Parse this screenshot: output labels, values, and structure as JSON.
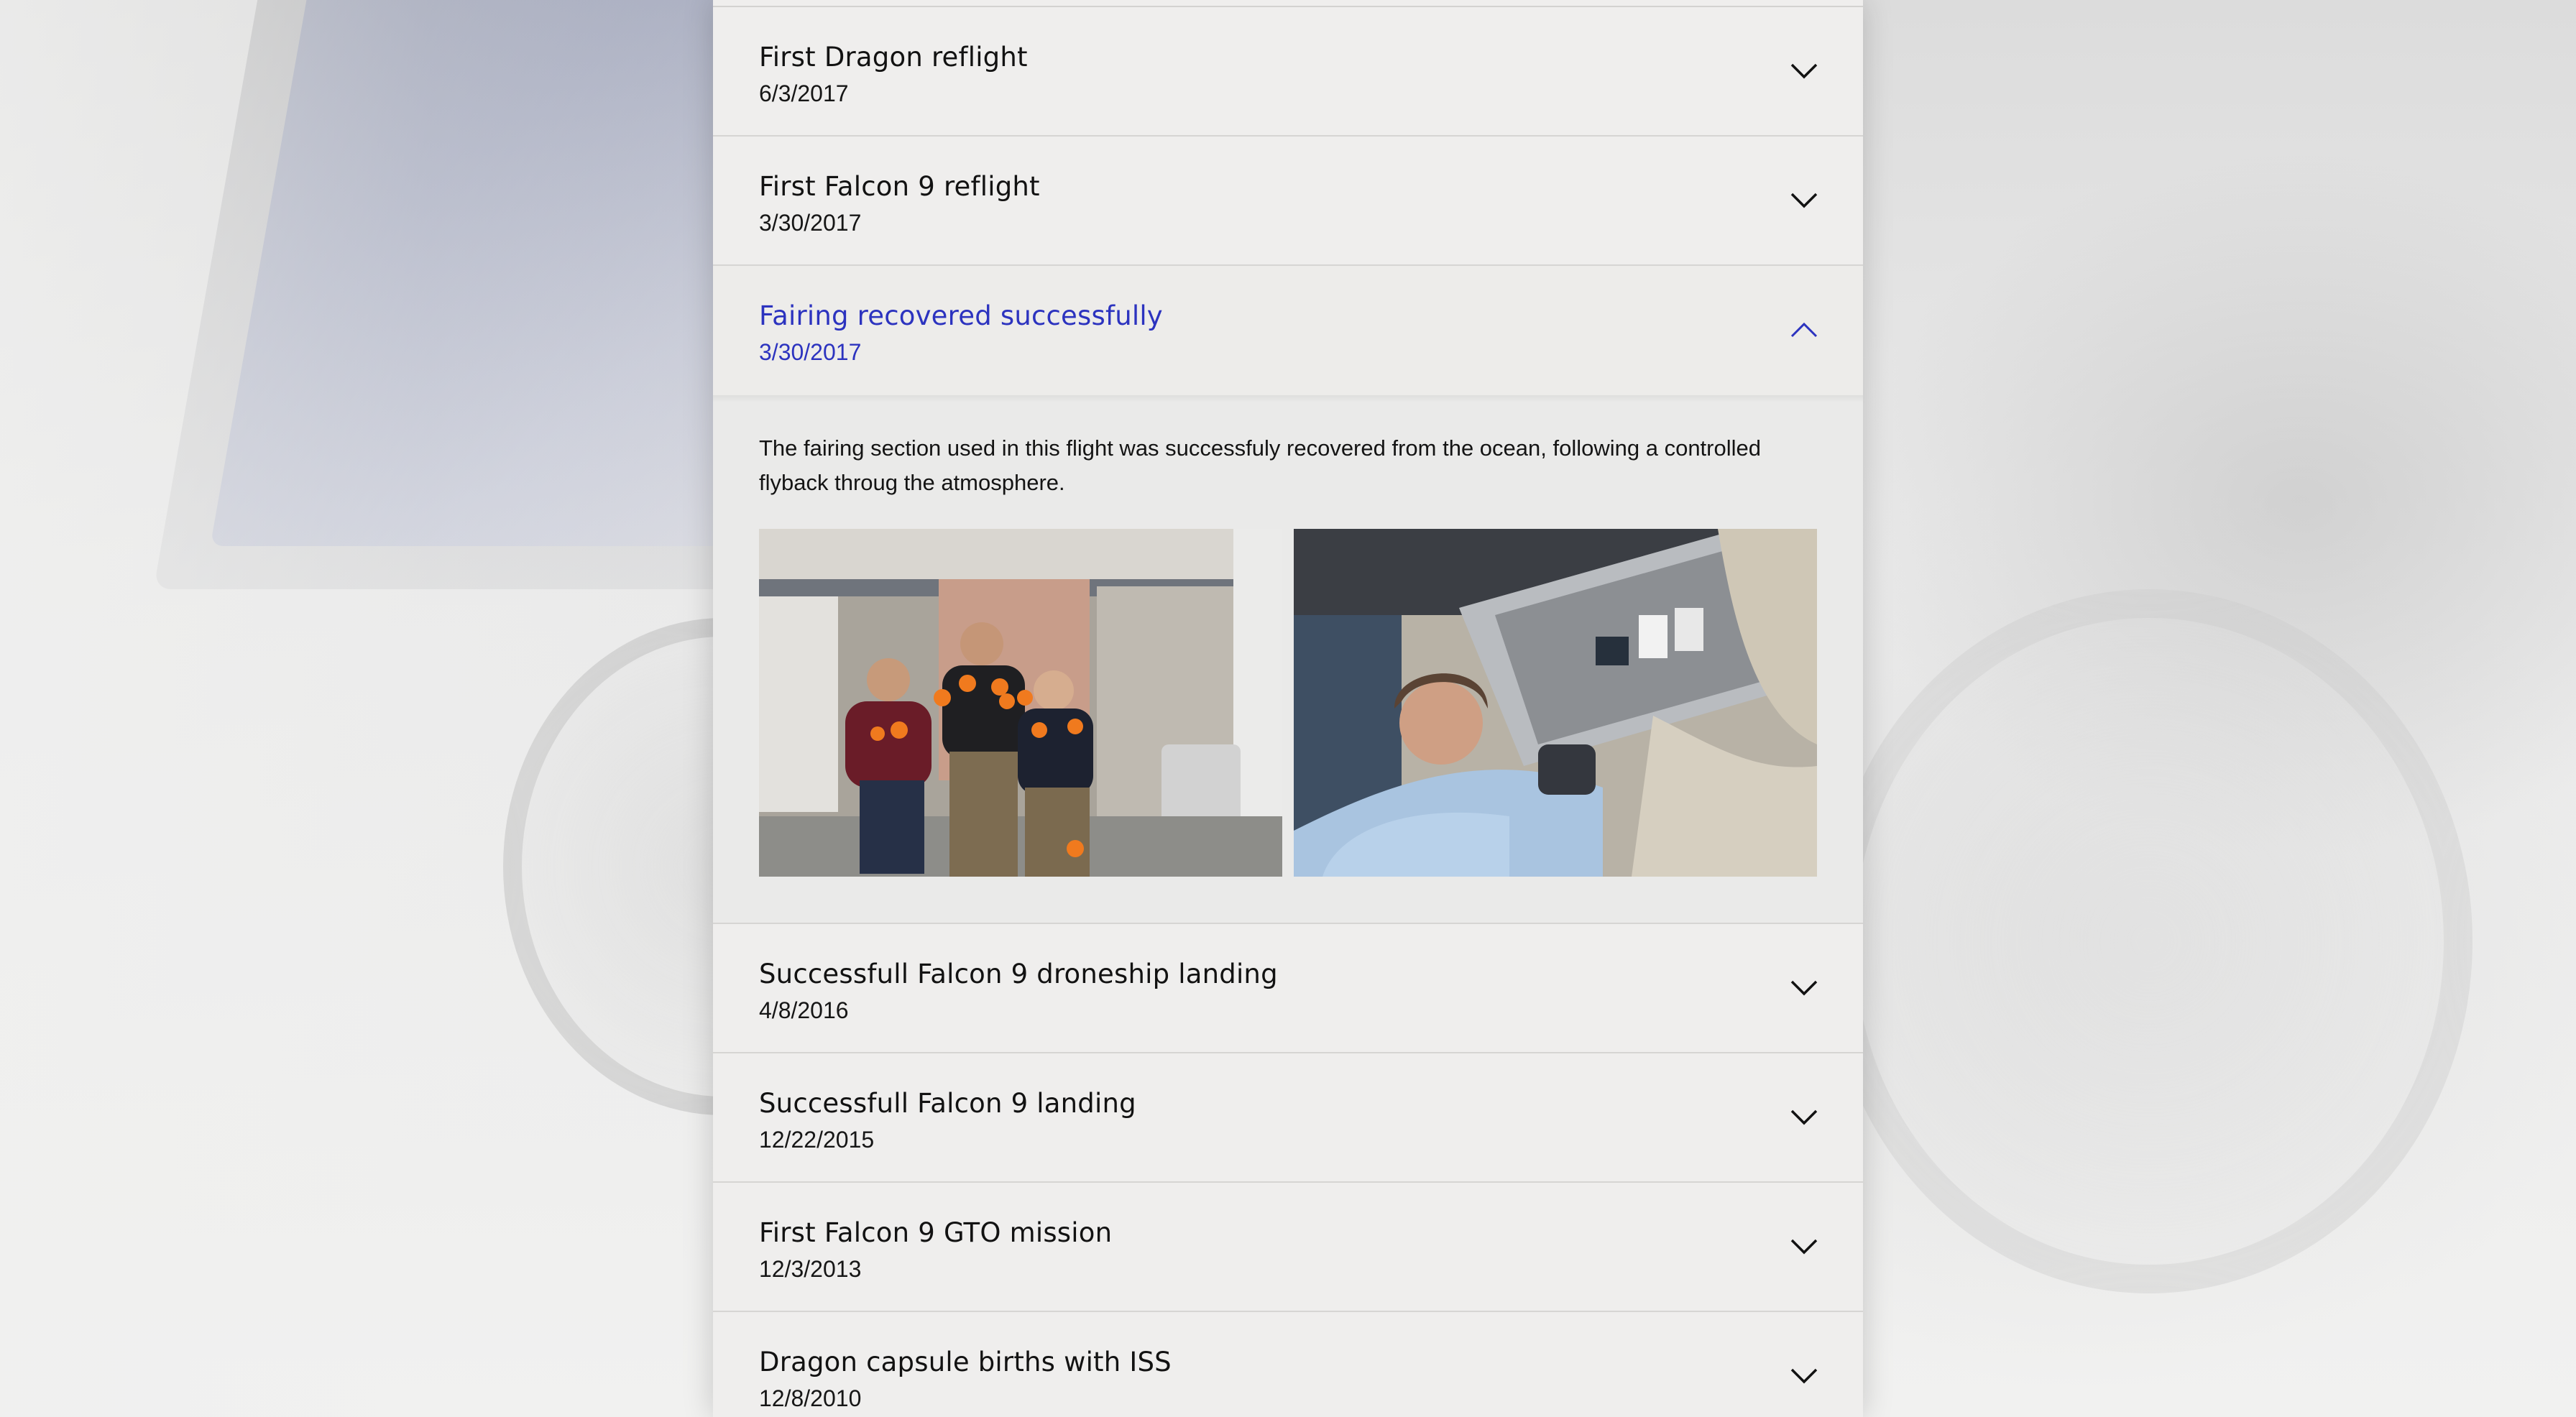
{
  "timeline": {
    "items": [
      {
        "title": "First Dragon reflight",
        "date": "6/3/2017",
        "expanded": false,
        "icon": "chevron-down-icon"
      },
      {
        "title": "First Falcon 9 reflight",
        "date": "3/30/2017",
        "expanded": false,
        "icon": "chevron-down-icon"
      },
      {
        "title": "Fairing recovered successfully",
        "date": "3/30/2017",
        "expanded": true,
        "icon": "chevron-up-icon",
        "description": "The fairing section used in this flight was successfuly recovered from the ocean, following a controlled flyback throug the atmosphere."
      },
      {
        "title": "Successfull Falcon 9 droneship landing",
        "date": "4/8/2016",
        "expanded": false,
        "icon": "chevron-down-icon"
      },
      {
        "title": "Successfull Falcon 9 landing",
        "date": "12/22/2015",
        "expanded": false,
        "icon": "chevron-down-icon"
      },
      {
        "title": "First Falcon 9 GTO mission",
        "date": "12/3/2013",
        "expanded": false,
        "icon": "chevron-down-icon"
      },
      {
        "title": "Dragon capsule births with ISS",
        "date": "12/8/2010",
        "expanded": false,
        "icon": "chevron-down-icon"
      }
    ]
  },
  "colors": {
    "accent": "#2c33bf",
    "text": "#121212",
    "panel": "#efeeed",
    "divider": "#d6d5d3"
  }
}
